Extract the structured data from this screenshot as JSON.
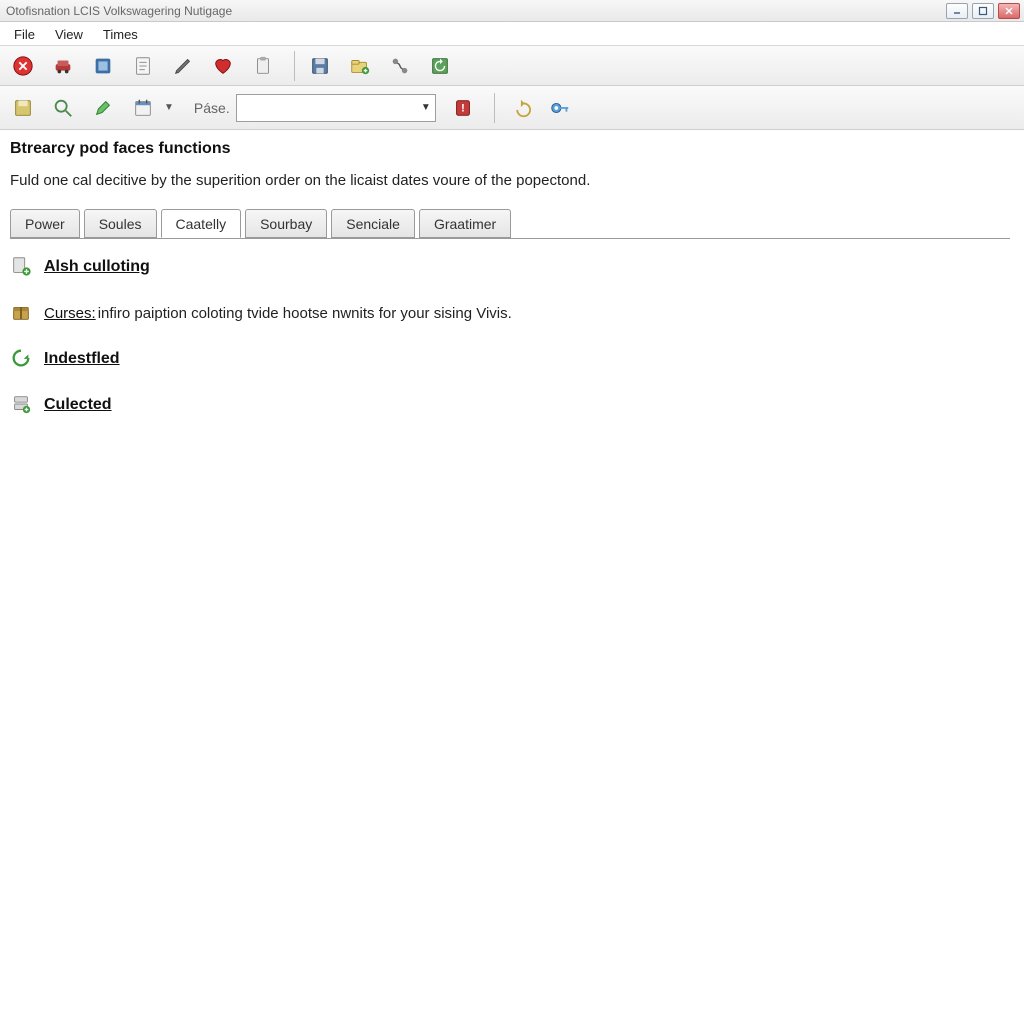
{
  "window": {
    "title": "Otofisnation LCIS Volkswagering Nutigage"
  },
  "menu": [
    {
      "label": "File"
    },
    {
      "label": "View"
    },
    {
      "label": "Times"
    }
  ],
  "toolbar1": {
    "buttons": [
      {
        "name": "close-round-icon"
      },
      {
        "name": "car-icon"
      },
      {
        "name": "module-icon"
      },
      {
        "name": "document-icon"
      },
      {
        "name": "pencil-icon"
      },
      {
        "name": "heart-icon"
      },
      {
        "name": "clipboard-icon"
      }
    ],
    "group2": [
      {
        "name": "save-disk-icon"
      },
      {
        "name": "folder-plus-icon"
      },
      {
        "name": "connector-icon"
      },
      {
        "name": "refresh-disk-icon"
      }
    ]
  },
  "toolbar2": {
    "left_buttons": [
      {
        "name": "disk-icon"
      },
      {
        "name": "magnifier-icon"
      },
      {
        "name": "highlighter-icon"
      },
      {
        "name": "calendar-icon"
      }
    ],
    "label": "Páse.",
    "combo_value": "",
    "right_buttons": [
      {
        "name": "alert-red-icon"
      },
      {
        "name": "undo-arrow-icon"
      },
      {
        "name": "key-icon"
      }
    ]
  },
  "page": {
    "title": "Btrearcy pod faces functions",
    "description": "Fuld one cal decitive by the superition order on the licaist dates voure of the popectond."
  },
  "tabs": [
    {
      "label": "Power",
      "active": false
    },
    {
      "label": "Soules",
      "active": false
    },
    {
      "label": "Caatelly",
      "active": true
    },
    {
      "label": "Sourbay",
      "active": false
    },
    {
      "label": "Senciale",
      "active": false
    },
    {
      "label": "Graatimer",
      "active": false
    }
  ],
  "items": [
    {
      "icon": "book-plus-icon",
      "label": "Alsh culloting",
      "bold": true
    },
    {
      "icon": "package-icon",
      "prefix": "Curses:",
      "tail": " infiro paiption coloting tvide hootse nwnits for your sising Vivis."
    },
    {
      "icon": "recycle-icon",
      "label": "Indestfled",
      "bold": true
    },
    {
      "icon": "server-icon",
      "label": "Culected",
      "bold": true
    }
  ]
}
